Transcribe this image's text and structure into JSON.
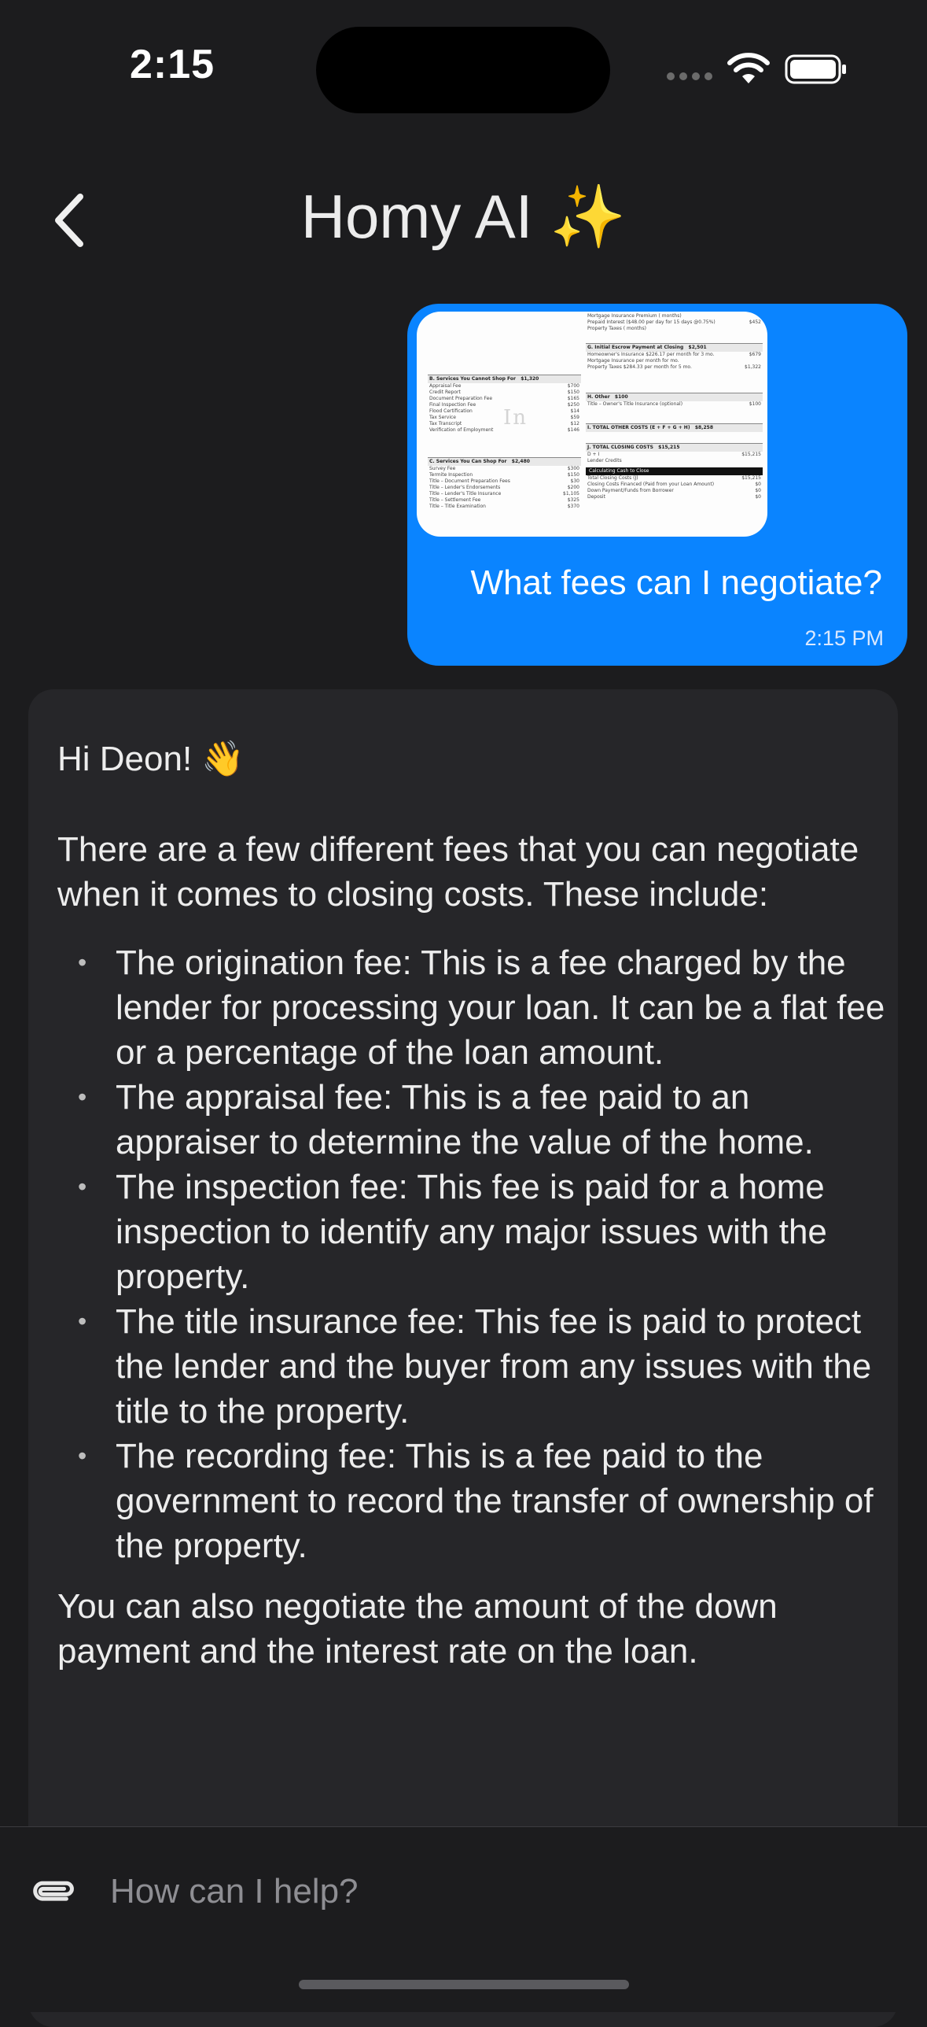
{
  "status_bar": {
    "time": "2:15"
  },
  "header": {
    "title": "Homy AI ✨"
  },
  "messages": {
    "user": {
      "text": "What fees can I negotiate?",
      "time": "2:15 PM",
      "attachment_icon": "document-image"
    },
    "assistant": {
      "greeting": "Hi Deon! 👋",
      "intro": "There are a few different fees that you can negotiate when it comes to closing costs. These include:",
      "items": [
        "The origination fee: This is a fee charged by the lender for processing your loan. It can be a flat fee or a percentage of the loan amount.",
        "The appraisal fee: This is a fee paid to an appraiser to determine the value of the home.",
        "The inspection fee: This fee is paid for a home inspection to identify any major issues with the property.",
        "The title insurance fee: This fee is paid to protect the lender and the buyer from any issues with the title to the property.",
        "The recording fee: This is a fee paid to the government to record the transfer of ownership of the property."
      ],
      "closing": "You can also negotiate the amount of the down payment and the interest rate on the loan."
    }
  },
  "composer": {
    "placeholder": "How can I help?"
  },
  "colors": {
    "background": "#1c1c1e",
    "user_bubble": "#0a84ff",
    "assistant_bubble": "#262629"
  }
}
